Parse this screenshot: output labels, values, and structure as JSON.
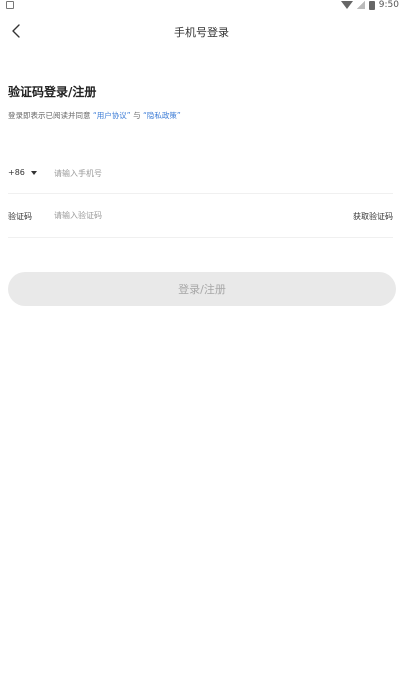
{
  "status_bar": {
    "time": "9:50"
  },
  "header": {
    "title": "手机号登录"
  },
  "section": {
    "title": "验证码登录/注册"
  },
  "agreement": {
    "prefix": "登录即表示已阅读并同意",
    "user_agreement": "“用户协议”",
    "joiner": "与",
    "privacy_policy": "“隐私政策”"
  },
  "phone": {
    "country_code": "+86",
    "placeholder": "请输入手机号"
  },
  "code": {
    "label": "验证码",
    "placeholder": "请输入验证码",
    "get_code": "获取验证码"
  },
  "submit": {
    "label": "登录/注册"
  },
  "colors": {
    "link": "#3b7bd6",
    "button_bg": "#e9e9e9",
    "button_text": "#a7a7a7"
  }
}
